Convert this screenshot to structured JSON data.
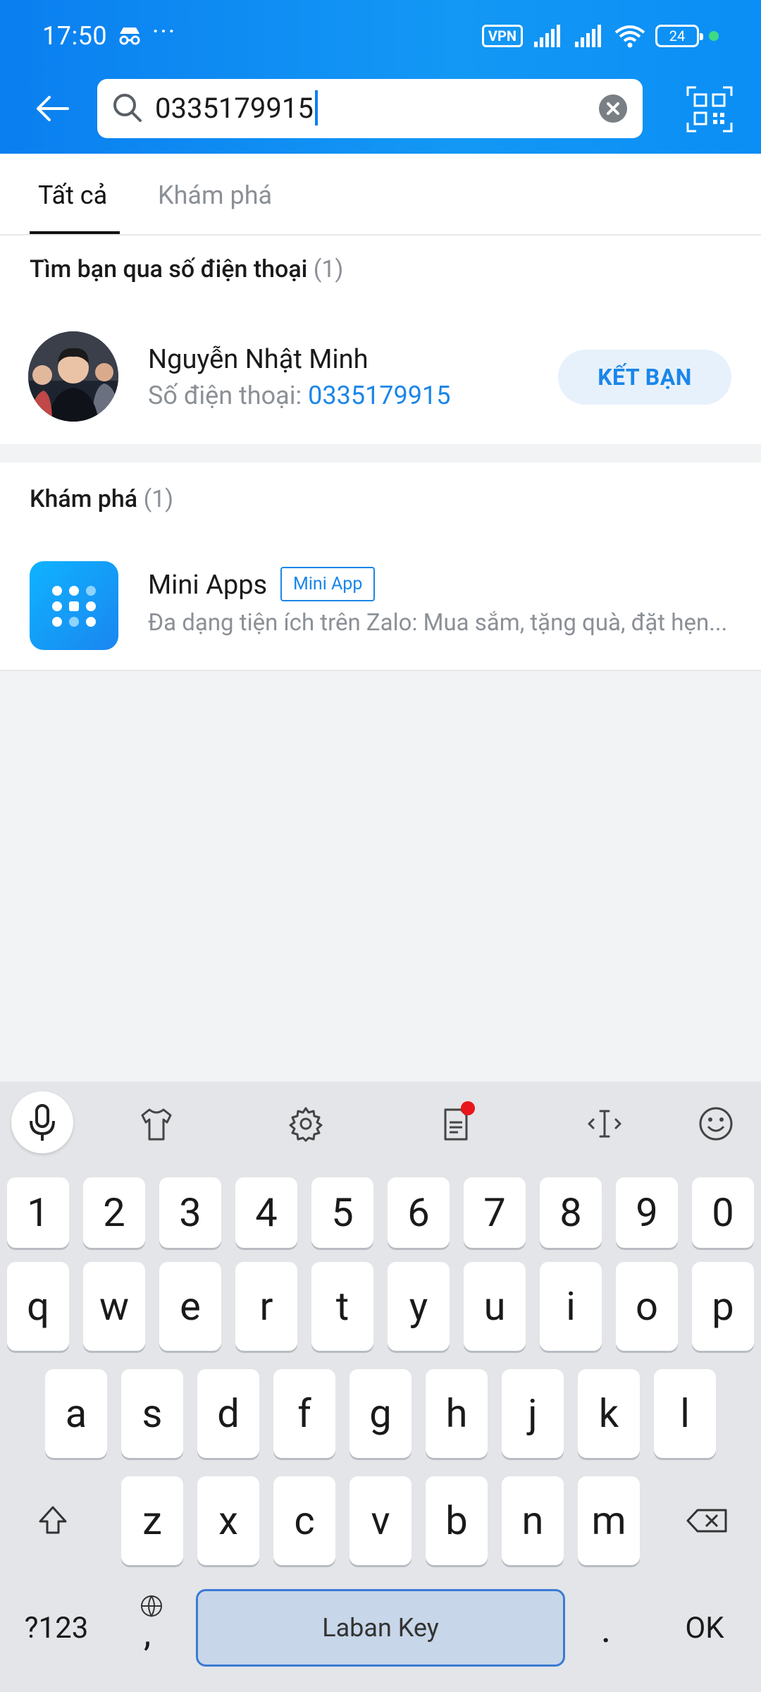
{
  "status_bar": {
    "time": "17:50",
    "vpn": "VPN",
    "battery": "24"
  },
  "search": {
    "value": "0335179915"
  },
  "tabs": [
    {
      "label": "Tất cả"
    },
    {
      "label": "Khám phá"
    }
  ],
  "friend_section": {
    "title": "Tìm bạn qua số điện thoại",
    "count": "(1)",
    "name": "Nguyễn Nhật Minh",
    "phone_label": "Số điện thoại: ",
    "phone": "0335179915",
    "add_button": "KẾT BẠN"
  },
  "discover_section": {
    "title": "Khám phá",
    "count": "(1)",
    "app_name": "Mini Apps",
    "badge": "Mini App",
    "description": "Đa dạng tiện ích trên Zalo: Mua sắm, tặng quà, đặt hẹn..."
  },
  "keyboard": {
    "row_numbers": [
      "1",
      "2",
      "3",
      "4",
      "5",
      "6",
      "7",
      "8",
      "9",
      "0"
    ],
    "row1": [
      "q",
      "w",
      "e",
      "r",
      "t",
      "y",
      "u",
      "i",
      "o",
      "p"
    ],
    "row2": [
      "a",
      "s",
      "d",
      "f",
      "g",
      "h",
      "j",
      "k",
      "l"
    ],
    "row3": [
      "z",
      "x",
      "c",
      "v",
      "b",
      "n",
      "m"
    ],
    "symbols_key": "?123",
    "comma_key": ",",
    "space_label": "Laban Key",
    "period_key": ".",
    "ok_key": "OK",
    "accent_color": "#1a86e8"
  }
}
